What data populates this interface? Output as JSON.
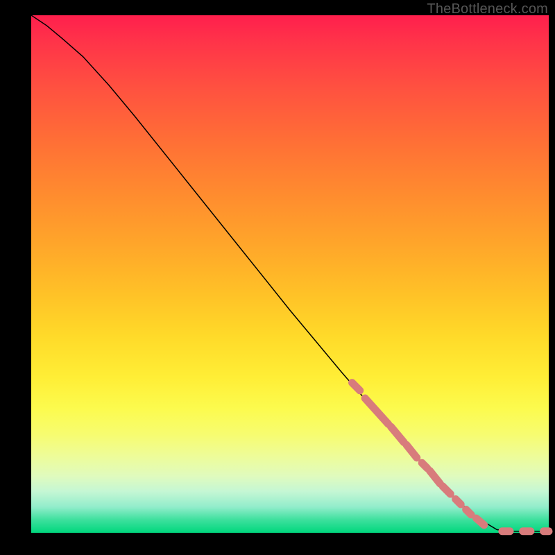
{
  "attribution": "TheBottleneck.com",
  "colors": {
    "dash": "#d87c7c",
    "curve": "#000000"
  },
  "chart_data": {
    "type": "line",
    "title": "",
    "xlabel": "",
    "ylabel": "",
    "xlim": [
      0,
      100
    ],
    "ylim": [
      0,
      100
    ],
    "series": [
      {
        "name": "curve",
        "x": [
          0,
          3,
          6,
          10,
          15,
          20,
          30,
          40,
          50,
          60,
          70,
          80,
          86,
          90,
          93,
          95,
          98,
          100
        ],
        "y": [
          100,
          98,
          95.5,
          92,
          86.5,
          80.5,
          68,
          55.5,
          43,
          31,
          19.5,
          8.5,
          3,
          0.6,
          0.3,
          0.3,
          0.3,
          0.3
        ]
      }
    ],
    "highlight_dashes": [
      {
        "x0": 62,
        "y0": 29,
        "x1": 63.5,
        "y1": 27.5
      },
      {
        "x0": 64.5,
        "y0": 26,
        "x1": 69,
        "y1": 21
      },
      {
        "x0": 69.5,
        "y0": 20.5,
        "x1": 72,
        "y1": 17.5
      },
      {
        "x0": 72.5,
        "y0": 17,
        "x1": 74.5,
        "y1": 14.5
      },
      {
        "x0": 75.5,
        "y0": 13.5,
        "x1": 76.5,
        "y1": 12.5
      },
      {
        "x0": 77,
        "y0": 12,
        "x1": 79,
        "y1": 9.5
      },
      {
        "x0": 79.5,
        "y0": 9,
        "x1": 81,
        "y1": 7.5
      },
      {
        "x0": 82,
        "y0": 6.5,
        "x1": 83,
        "y1": 5.5
      },
      {
        "x0": 84,
        "y0": 4.5,
        "x1": 85,
        "y1": 3.5
      },
      {
        "x0": 86,
        "y0": 2.8,
        "x1": 87.5,
        "y1": 1.5
      },
      {
        "x0": 91,
        "y0": 0.3,
        "x1": 92.5,
        "y1": 0.3
      },
      {
        "x0": 95,
        "y0": 0.3,
        "x1": 96.5,
        "y1": 0.3
      },
      {
        "x0": 99,
        "y0": 0.3,
        "x1": 100,
        "y1": 0.3
      }
    ]
  }
}
